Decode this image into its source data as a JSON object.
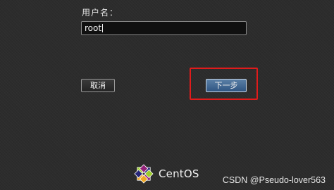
{
  "login": {
    "username_label": "用户名：",
    "username_value": "root"
  },
  "buttons": {
    "cancel_label": "取消",
    "next_label": "下一步"
  },
  "branding": {
    "os_name": "CentOS"
  },
  "watermark": {
    "text": "CSDN @Pseudo-lover563"
  },
  "colors": {
    "background": "#2c2c2c",
    "highlight": "#e01b1b",
    "next_button": "#3d6592",
    "logo_purple": "#932279",
    "logo_yellow": "#efa724",
    "logo_green": "#9ccd2a",
    "logo_blue": "#262577"
  },
  "icons": {
    "logo": "centos-logo-icon"
  }
}
